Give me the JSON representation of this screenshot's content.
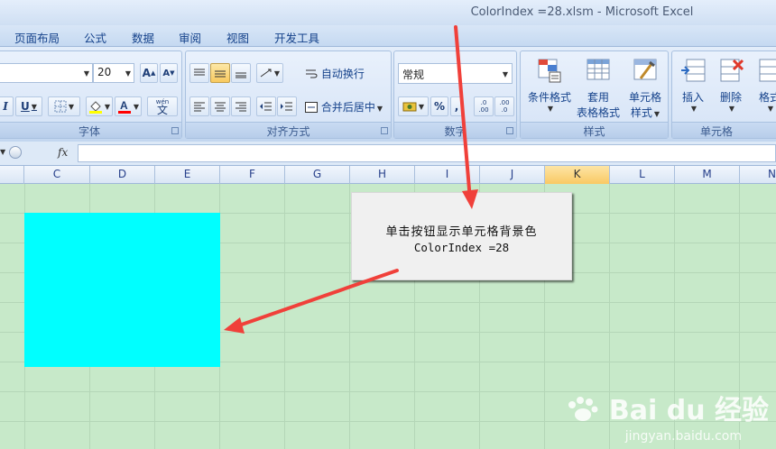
{
  "window": {
    "title": "ColorIndex =28.xlsm - Microsoft Excel"
  },
  "tabs": [
    "页面布局",
    "公式",
    "数据",
    "审阅",
    "视图",
    "开发工具"
  ],
  "ribbon": {
    "font_group": {
      "label": "字体",
      "font_size": "20",
      "bold_italic": "I",
      "underline": "U",
      "wen": "wén",
      "wen_char": "文"
    },
    "align_group": {
      "label": "对齐方式",
      "wrap": "自动换行",
      "merge": "合并后居中"
    },
    "number_group": {
      "label": "数字",
      "format": "常规",
      "percent": "%",
      "inc": ".0 .00",
      "dec": ".00 .0"
    },
    "style_group": {
      "label": "样式",
      "cond": "条件格式",
      "table1": "套用",
      "table2": "表格格式",
      "cell1": "单元格",
      "cell2": "样式"
    },
    "cells_group": {
      "label": "单元格",
      "insert": "插入",
      "delete": "删除",
      "format": "格式"
    }
  },
  "formula_bar": {
    "fx": "fx",
    "value": ""
  },
  "columns": [
    "C",
    "D",
    "E",
    "F",
    "G",
    "H",
    "I",
    "J",
    "K",
    "L",
    "M",
    "N"
  ],
  "active_column": "K",
  "cell_fill_color": "#00FFFF",
  "popup": {
    "line1": "单击按钮显示单元格背景色",
    "line2": "ColorIndex =28"
  },
  "watermark": {
    "brand": "Bai du 经验",
    "url": "jingyan.baidu.com"
  },
  "colors": {
    "grid_bg": "#C7E9C9",
    "arrow": "#F0403A",
    "cyan": "#00FFFF"
  }
}
